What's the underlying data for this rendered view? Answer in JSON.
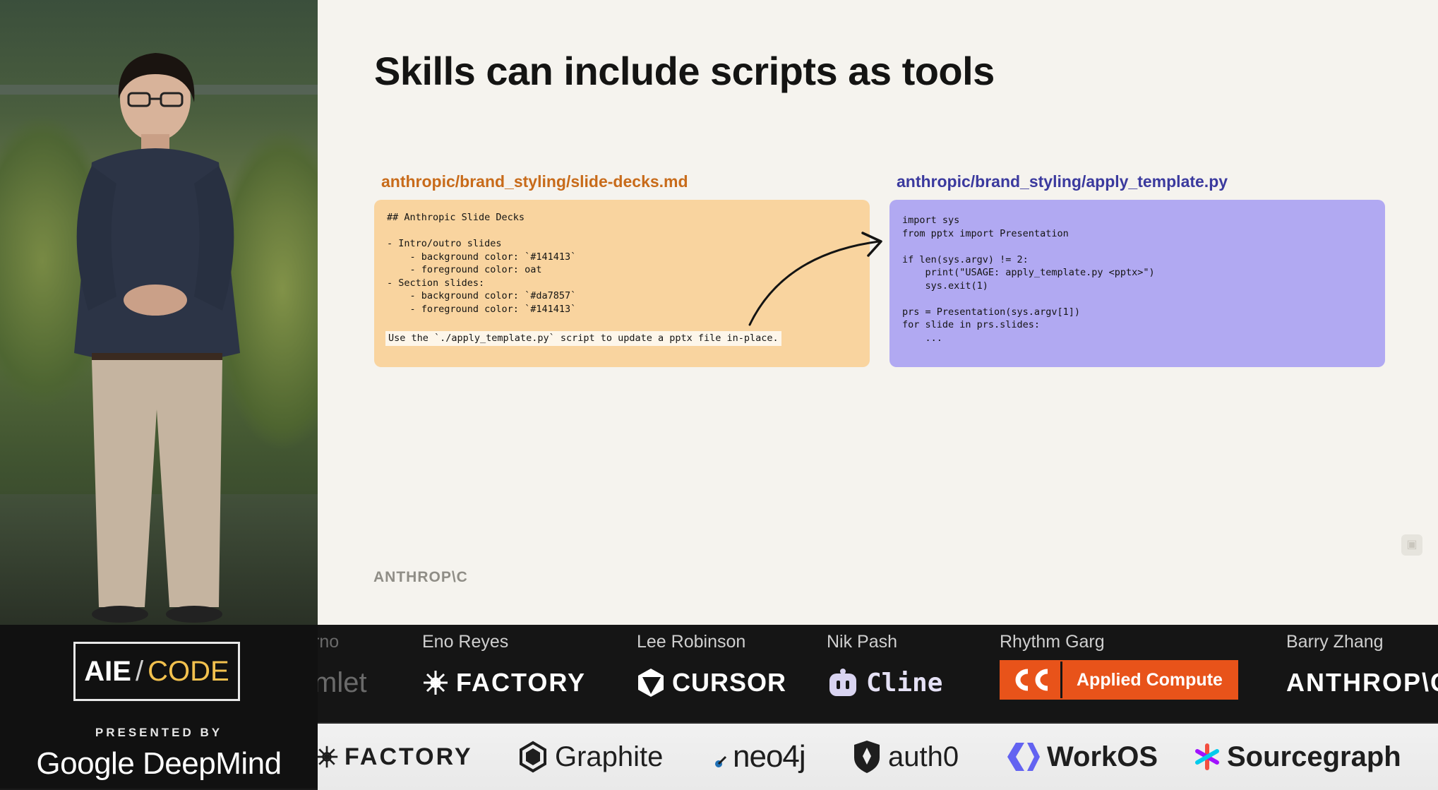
{
  "slide": {
    "title": "Skills can include scripts as tools",
    "md_file": {
      "label": "anthropic/brand_styling/slide-decks.md",
      "lines": [
        "## Anthropic Slide Decks",
        "",
        "- Intro/outro slides",
        "    - background color: `#141413`",
        "    - foreground color: oat",
        "- Section slides:",
        "    - background color: `#da7857`",
        "    - foreground color: `#141413`"
      ],
      "highlight": "Use the `./apply_template.py` script to update a pptx file in-place."
    },
    "py_file": {
      "label": "anthropic/brand_styling/apply_template.py",
      "lines": [
        "import sys",
        "from pptx import Presentation",
        "",
        "if len(sys.argv) != 2:",
        "    print(\"USAGE: apply_template.py <pptx>\")",
        "    sys.exit(1)",
        "",
        "prs = Presentation(sys.argv[1])",
        "for slide in prs.slides:",
        "    ..."
      ]
    },
    "footer_logo": "ANTHROP\\C",
    "colors": {
      "background": "#f5f3ee",
      "md_box": "#f9d49f",
      "py_box": "#b1a9f2",
      "md_label": "#c86b1a",
      "py_label": "#3b3a9e"
    }
  },
  "event": {
    "badge_main": "AIE",
    "badge_slash": "/",
    "badge_sub": "CODE",
    "presented_by": "PRESENTED BY",
    "presenter": "Google DeepMind"
  },
  "speakers": [
    {
      "name": "rno",
      "company": "mlet"
    },
    {
      "name": "Eno Reyes",
      "company": "FACTORY",
      "icon": "factory-icon"
    },
    {
      "name": "Lee Robinson",
      "company": "CURSOR",
      "icon": "cursor-icon"
    },
    {
      "name": "Nik Pash",
      "company": "Cline",
      "icon": "cline-icon"
    },
    {
      "name": "Rhythm Garg",
      "company": "Applied Compute",
      "icon": "applied-compute-icon"
    },
    {
      "name": "Barry Zhang",
      "company": "ANTHROP\\C"
    }
  ],
  "sponsors": [
    {
      "name": "FACTORY",
      "icon": "factory-icon"
    },
    {
      "name": "Graphite",
      "icon": "graphite-icon"
    },
    {
      "name": "neo4j",
      "icon": "neo4j-icon"
    },
    {
      "name": "auth0",
      "icon": "auth0-icon"
    },
    {
      "name": "WorkOS",
      "icon": "workos-icon"
    },
    {
      "name": "Sourcegraph",
      "icon": "sourcegraph-icon"
    }
  ]
}
